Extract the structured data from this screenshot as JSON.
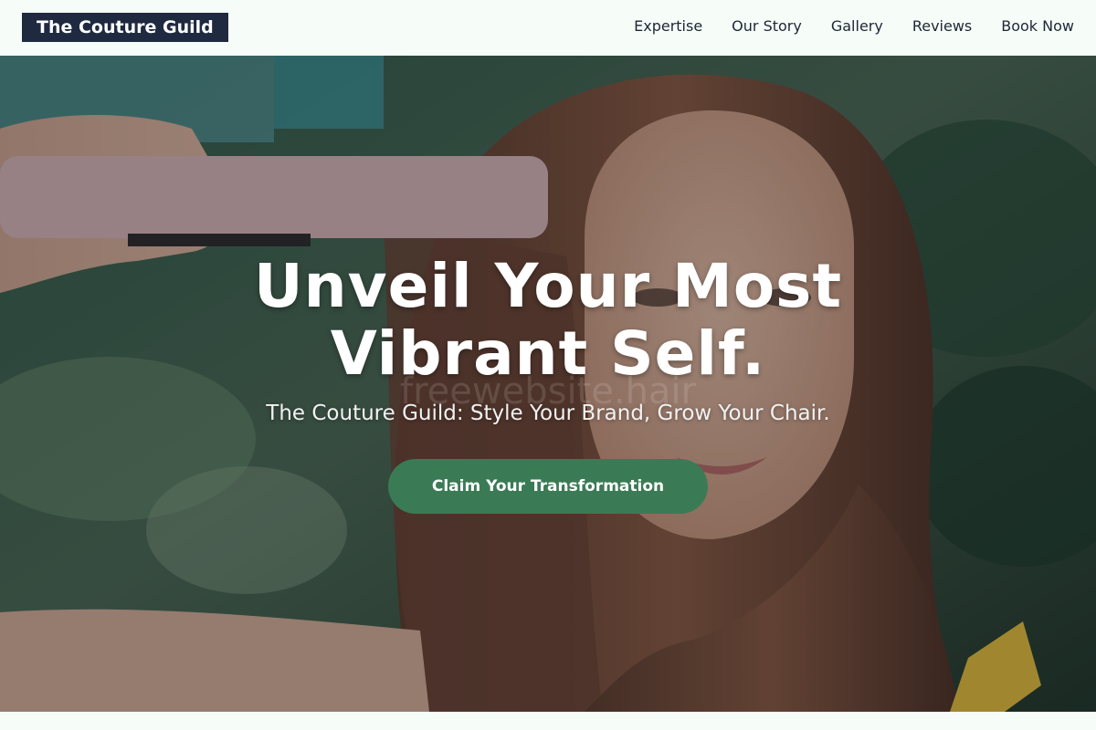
{
  "brand": {
    "name": "The Couture Guild"
  },
  "nav": {
    "items": [
      {
        "label": "Expertise"
      },
      {
        "label": "Our Story"
      },
      {
        "label": "Gallery"
      },
      {
        "label": "Reviews"
      },
      {
        "label": "Book Now"
      }
    ]
  },
  "hero": {
    "title": "Unveil Your Most Vibrant Self.",
    "subtitle": "The Couture Guild: Style Your Brand, Grow Your Chair.",
    "cta_label": "Claim Your Transformation",
    "watermark": "freewebsite.hair",
    "image_alt": "woman straightening long brown hair with pink flat iron"
  },
  "colors": {
    "background": "#f6fdf8",
    "logo_bg": "#1f2a40",
    "cta": "#3a7b55",
    "nav_text": "#1e2636"
  }
}
